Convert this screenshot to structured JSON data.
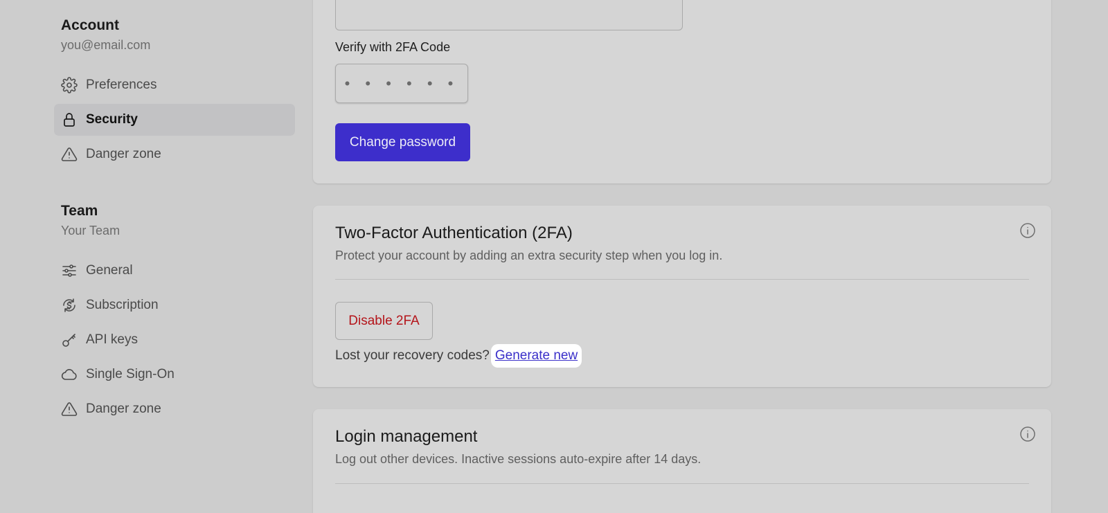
{
  "sidebar": {
    "account": {
      "title": "Account",
      "email": "you@email.com",
      "items": [
        {
          "label": "Preferences",
          "icon": "gear-icon"
        },
        {
          "label": "Security",
          "icon": "lock-icon",
          "active": true
        },
        {
          "label": "Danger zone",
          "icon": "warning-icon"
        }
      ]
    },
    "team": {
      "title": "Team",
      "subtitle": "Your Team",
      "items": [
        {
          "label": "General",
          "icon": "sliders-icon"
        },
        {
          "label": "Subscription",
          "icon": "dollar-cycle-icon"
        },
        {
          "label": "API keys",
          "icon": "key-icon"
        },
        {
          "label": "Single Sign-On",
          "icon": "cloud-icon"
        },
        {
          "label": "Danger zone",
          "icon": "warning-icon"
        }
      ]
    }
  },
  "password_card": {
    "code_label": "Verify with 2FA Code",
    "code_value": "• • • • • •",
    "change_button": "Change password"
  },
  "twofa_card": {
    "title": "Two-Factor Authentication (2FA)",
    "description": "Protect your account by adding an extra security step when you log in.",
    "disable_button": "Disable 2FA",
    "recovery_text": "Lost your recovery codes?",
    "generate_link": "Generate new"
  },
  "login_card": {
    "title": "Login management",
    "description": "Log out other devices. Inactive sessions auto-expire after 14 days."
  },
  "colors": {
    "accent": "#3d2ecb",
    "danger": "#b4141a",
    "link": "#3a2fc9"
  }
}
